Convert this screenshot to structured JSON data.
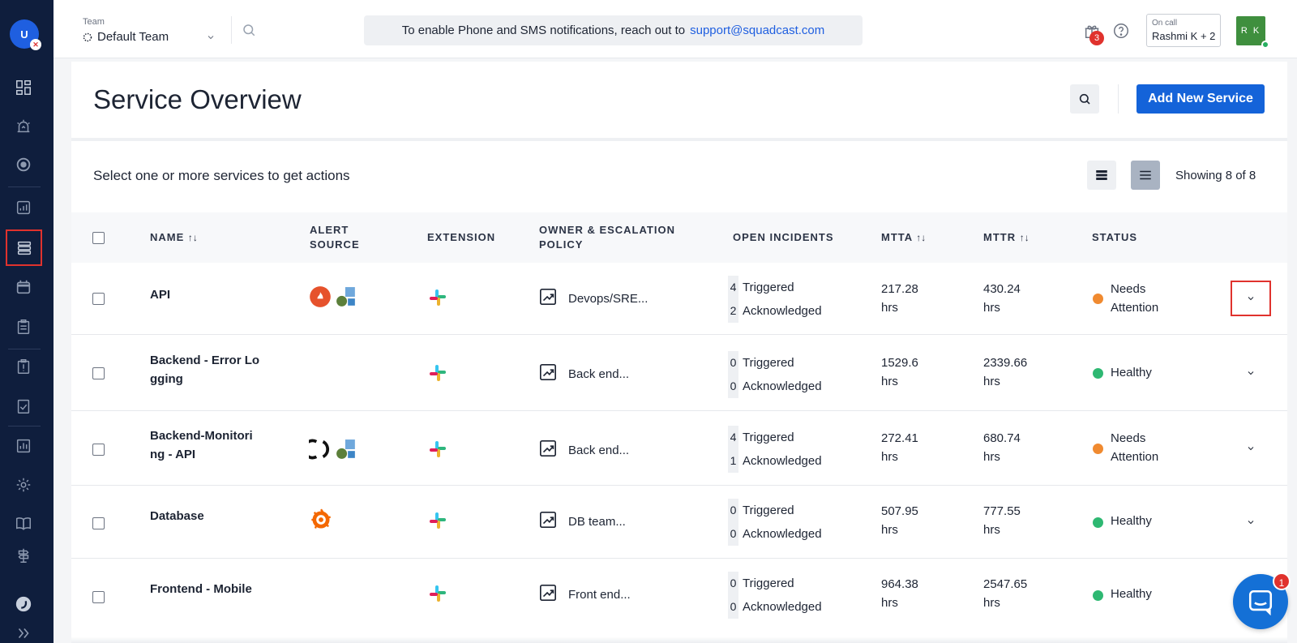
{
  "sidebar": {
    "avatar_initial": "U",
    "avatar_badge": "✕",
    "items": [
      {
        "icon": "dashboard-icon"
      },
      {
        "icon": "alert-siren-icon"
      },
      {
        "icon": "target-icon"
      },
      {
        "icon": "analytics-icon"
      },
      {
        "icon": "services-icon",
        "active": true
      },
      {
        "icon": "calendar-icon"
      },
      {
        "icon": "clipboard-icon"
      },
      {
        "icon": "runbook-icon"
      },
      {
        "icon": "checklist-icon"
      },
      {
        "icon": "reports-icon"
      },
      {
        "icon": "settings-gear-icon"
      },
      {
        "icon": "book-icon"
      },
      {
        "icon": "signpost-icon"
      },
      {
        "icon": "squadcast-logo-icon"
      },
      {
        "icon": "expand-chevrons-icon"
      }
    ]
  },
  "topbar": {
    "team_label": "Team",
    "team_value": "Default Team",
    "banner_text": "To enable Phone and SMS notifications, reach out to",
    "banner_link": "support@squadcast.com",
    "gift_badge": "3",
    "oncall_label": "On call",
    "oncall_value": "Rashmi K + 2",
    "user_initials": "R K"
  },
  "page": {
    "title": "Service Overview",
    "add_button": "Add New Service",
    "select_hint": "Select one or more services to get actions",
    "showing": "Showing 8 of 8"
  },
  "table": {
    "headers": {
      "name": "NAME",
      "alert_source_1": "ALERT",
      "alert_source_2": "SOURCE",
      "extension": "EXTENSION",
      "owner_1": "OWNER & ESCALATION",
      "owner_2": "POLICY",
      "open_incidents": "OPEN INCIDENTS",
      "mtta": "MTTA",
      "mttr": "MTTR",
      "status": "STATUS"
    },
    "triggered_label": "Triggered",
    "acknowledged_label": "Acknowledged",
    "hrs_label": "hrs",
    "rows": [
      {
        "name_1": "API",
        "name_2": "",
        "owner": "Devops/SRE...",
        "triggered": "4",
        "acknowledged": "2",
        "mtta": "217.28",
        "mttr": "430.24",
        "status_1": "Needs",
        "status_2": "Attention",
        "status_color": "#f08a30"
      },
      {
        "name_1": "Backend - Error Lo",
        "name_2": "gging",
        "owner": "Back end...",
        "triggered": "0",
        "acknowledged": "0",
        "mtta": "1529.6",
        "mttr": "2339.66",
        "status_1": "Healthy",
        "status_2": "",
        "status_color": "#2eb872"
      },
      {
        "name_1": "Backend-Monitori",
        "name_2": "ng - API",
        "owner": "Back end...",
        "triggered": "4",
        "acknowledged": "1",
        "mtta": "272.41",
        "mttr": "680.74",
        "status_1": "Needs",
        "status_2": "Attention",
        "status_color": "#f08a30"
      },
      {
        "name_1": "Database",
        "name_2": "",
        "owner": "DB team...",
        "triggered": "0",
        "acknowledged": "0",
        "mtta": "507.95",
        "mttr": "777.55",
        "status_1": "Healthy",
        "status_2": "",
        "status_color": "#2eb872"
      },
      {
        "name_1": "Frontend - Mobile",
        "name_2": "",
        "owner": "Front end...",
        "triggered": "0",
        "acknowledged": "0",
        "mtta": "964.38",
        "mttr": "2547.65",
        "status_1": "Healthy",
        "status_2": "",
        "status_color": "#2eb872"
      }
    ]
  },
  "chat": {
    "badge": "1"
  },
  "colors": {
    "sidebar": "#0f1e3d",
    "primary": "#1463d9",
    "highlight": "#e0322d"
  }
}
